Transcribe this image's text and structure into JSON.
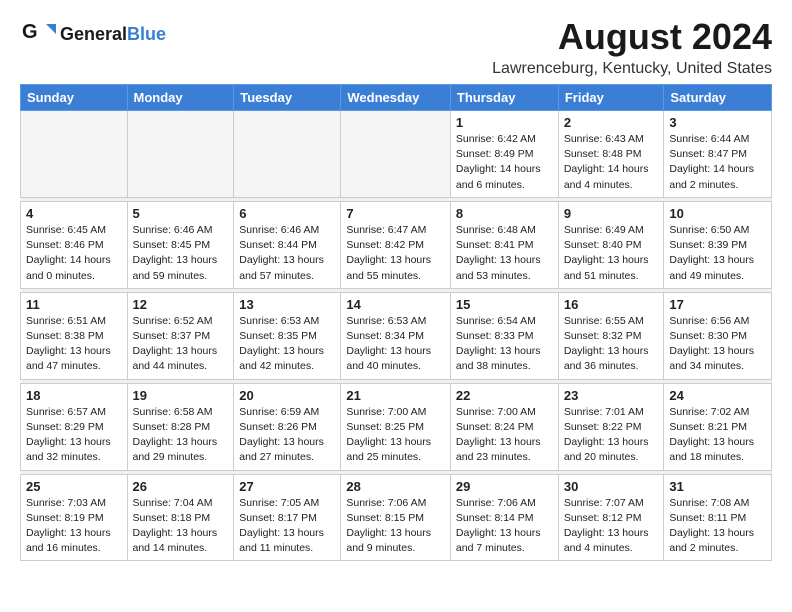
{
  "header": {
    "logo_general": "General",
    "logo_blue": "Blue",
    "month": "August 2024",
    "location": "Lawrenceburg, Kentucky, United States"
  },
  "days_of_week": [
    "Sunday",
    "Monday",
    "Tuesday",
    "Wednesday",
    "Thursday",
    "Friday",
    "Saturday"
  ],
  "weeks": [
    [
      {
        "day": "",
        "info": ""
      },
      {
        "day": "",
        "info": ""
      },
      {
        "day": "",
        "info": ""
      },
      {
        "day": "",
        "info": ""
      },
      {
        "day": "1",
        "info": "Sunrise: 6:42 AM\nSunset: 8:49 PM\nDaylight: 14 hours\nand 6 minutes."
      },
      {
        "day": "2",
        "info": "Sunrise: 6:43 AM\nSunset: 8:48 PM\nDaylight: 14 hours\nand 4 minutes."
      },
      {
        "day": "3",
        "info": "Sunrise: 6:44 AM\nSunset: 8:47 PM\nDaylight: 14 hours\nand 2 minutes."
      }
    ],
    [
      {
        "day": "4",
        "info": "Sunrise: 6:45 AM\nSunset: 8:46 PM\nDaylight: 14 hours\nand 0 minutes."
      },
      {
        "day": "5",
        "info": "Sunrise: 6:46 AM\nSunset: 8:45 PM\nDaylight: 13 hours\nand 59 minutes."
      },
      {
        "day": "6",
        "info": "Sunrise: 6:46 AM\nSunset: 8:44 PM\nDaylight: 13 hours\nand 57 minutes."
      },
      {
        "day": "7",
        "info": "Sunrise: 6:47 AM\nSunset: 8:42 PM\nDaylight: 13 hours\nand 55 minutes."
      },
      {
        "day": "8",
        "info": "Sunrise: 6:48 AM\nSunset: 8:41 PM\nDaylight: 13 hours\nand 53 minutes."
      },
      {
        "day": "9",
        "info": "Sunrise: 6:49 AM\nSunset: 8:40 PM\nDaylight: 13 hours\nand 51 minutes."
      },
      {
        "day": "10",
        "info": "Sunrise: 6:50 AM\nSunset: 8:39 PM\nDaylight: 13 hours\nand 49 minutes."
      }
    ],
    [
      {
        "day": "11",
        "info": "Sunrise: 6:51 AM\nSunset: 8:38 PM\nDaylight: 13 hours\nand 47 minutes."
      },
      {
        "day": "12",
        "info": "Sunrise: 6:52 AM\nSunset: 8:37 PM\nDaylight: 13 hours\nand 44 minutes."
      },
      {
        "day": "13",
        "info": "Sunrise: 6:53 AM\nSunset: 8:35 PM\nDaylight: 13 hours\nand 42 minutes."
      },
      {
        "day": "14",
        "info": "Sunrise: 6:53 AM\nSunset: 8:34 PM\nDaylight: 13 hours\nand 40 minutes."
      },
      {
        "day": "15",
        "info": "Sunrise: 6:54 AM\nSunset: 8:33 PM\nDaylight: 13 hours\nand 38 minutes."
      },
      {
        "day": "16",
        "info": "Sunrise: 6:55 AM\nSunset: 8:32 PM\nDaylight: 13 hours\nand 36 minutes."
      },
      {
        "day": "17",
        "info": "Sunrise: 6:56 AM\nSunset: 8:30 PM\nDaylight: 13 hours\nand 34 minutes."
      }
    ],
    [
      {
        "day": "18",
        "info": "Sunrise: 6:57 AM\nSunset: 8:29 PM\nDaylight: 13 hours\nand 32 minutes."
      },
      {
        "day": "19",
        "info": "Sunrise: 6:58 AM\nSunset: 8:28 PM\nDaylight: 13 hours\nand 29 minutes."
      },
      {
        "day": "20",
        "info": "Sunrise: 6:59 AM\nSunset: 8:26 PM\nDaylight: 13 hours\nand 27 minutes."
      },
      {
        "day": "21",
        "info": "Sunrise: 7:00 AM\nSunset: 8:25 PM\nDaylight: 13 hours\nand 25 minutes."
      },
      {
        "day": "22",
        "info": "Sunrise: 7:00 AM\nSunset: 8:24 PM\nDaylight: 13 hours\nand 23 minutes."
      },
      {
        "day": "23",
        "info": "Sunrise: 7:01 AM\nSunset: 8:22 PM\nDaylight: 13 hours\nand 20 minutes."
      },
      {
        "day": "24",
        "info": "Sunrise: 7:02 AM\nSunset: 8:21 PM\nDaylight: 13 hours\nand 18 minutes."
      }
    ],
    [
      {
        "day": "25",
        "info": "Sunrise: 7:03 AM\nSunset: 8:19 PM\nDaylight: 13 hours\nand 16 minutes."
      },
      {
        "day": "26",
        "info": "Sunrise: 7:04 AM\nSunset: 8:18 PM\nDaylight: 13 hours\nand 14 minutes."
      },
      {
        "day": "27",
        "info": "Sunrise: 7:05 AM\nSunset: 8:17 PM\nDaylight: 13 hours\nand 11 minutes."
      },
      {
        "day": "28",
        "info": "Sunrise: 7:06 AM\nSunset: 8:15 PM\nDaylight: 13 hours\nand 9 minutes."
      },
      {
        "day": "29",
        "info": "Sunrise: 7:06 AM\nSunset: 8:14 PM\nDaylight: 13 hours\nand 7 minutes."
      },
      {
        "day": "30",
        "info": "Sunrise: 7:07 AM\nSunset: 8:12 PM\nDaylight: 13 hours\nand 4 minutes."
      },
      {
        "day": "31",
        "info": "Sunrise: 7:08 AM\nSunset: 8:11 PM\nDaylight: 13 hours\nand 2 minutes."
      }
    ]
  ]
}
